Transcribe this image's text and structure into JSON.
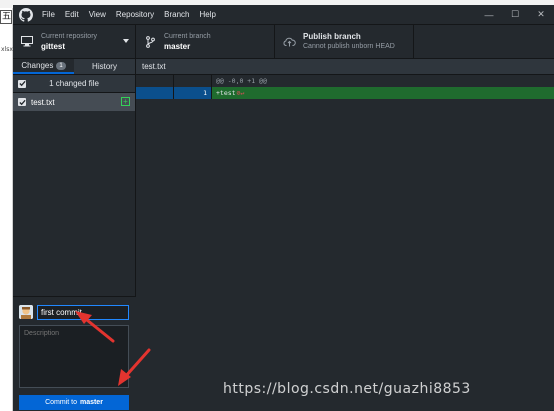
{
  "background": {
    "box_text": "五",
    "file_ext": "xlsx"
  },
  "window": {
    "menu": [
      "File",
      "Edit",
      "View",
      "Repository",
      "Branch",
      "Help"
    ],
    "controls": {
      "minimize": "—",
      "maximize": "☐",
      "close": "✕"
    }
  },
  "toolbar": {
    "repository": {
      "caption": "Current repository",
      "value": "gittest",
      "icon": "desktop-icon"
    },
    "branch": {
      "caption": "Current branch",
      "value": "master",
      "icon": "branch-icon"
    },
    "publish": {
      "title": "Publish branch",
      "subtitle": "Cannot publish unborn HEAD",
      "icon": "cloud-upload-icon"
    }
  },
  "sidebar": {
    "tabs": [
      {
        "label": "Changes",
        "badge": "1",
        "active": true
      },
      {
        "label": "History",
        "active": false
      }
    ],
    "changed_header": "1 changed file",
    "files": [
      {
        "name": "test.txt",
        "checked": true,
        "status": "+"
      }
    ]
  },
  "commit": {
    "summary_value": "first commit",
    "description_placeholder": "Description",
    "button_prefix": "Commit to",
    "button_branch": "master"
  },
  "diff": {
    "file_name": "test.txt",
    "hunk_header": "@@ -0,0 +1 @@",
    "lines": [
      {
        "old": "",
        "new": "1",
        "text": "+test",
        "eol_marker": "⊘↵"
      }
    ]
  },
  "watermark": "https://blog.csdn.net/guazhi8853",
  "colors": {
    "app_bg": "#24292e",
    "accent": "#0366d6",
    "added_line": "#1f6b2e",
    "arrow": "#e3342f"
  }
}
